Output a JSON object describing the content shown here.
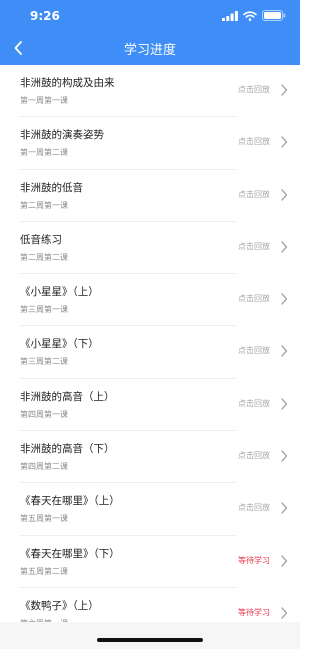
{
  "status_bar": {
    "time": "9:26"
  },
  "nav": {
    "title": "学习进度"
  },
  "items": [
    {
      "name": "非洲鼓的构成及由来",
      "sub": "第一周第一课",
      "status": "点击回放",
      "waiting": false
    },
    {
      "name": "非洲鼓的演奏姿势",
      "sub": "第一周第二课",
      "status": "点击回放",
      "waiting": false
    },
    {
      "name": "非洲鼓的低音",
      "sub": "第二周第一课",
      "status": "点击回放",
      "waiting": false
    },
    {
      "name": "低音练习",
      "sub": "第二周第二课",
      "status": "点击回放",
      "waiting": false
    },
    {
      "name": "《小星星》（上）",
      "sub": "第三周第一课",
      "status": "点击回放",
      "waiting": false
    },
    {
      "name": "《小星星》（下）",
      "sub": "第三周第二课",
      "status": "点击回放",
      "waiting": false
    },
    {
      "name": "非洲鼓的高音（上）",
      "sub": "第四周第一课",
      "status": "点击回放",
      "waiting": false
    },
    {
      "name": "非洲鼓的高音（下）",
      "sub": "第四周第二课",
      "status": "点击回放",
      "waiting": false
    },
    {
      "name": "《春天在哪里》（上）",
      "sub": "第五周第一课",
      "status": "点击回放",
      "waiting": false
    },
    {
      "name": "《春天在哪里》（下）",
      "sub": "第五周第二课",
      "status": "等待学习",
      "waiting": true
    },
    {
      "name": "《数鸭子》（上）",
      "sub": "第六周第一课",
      "status": "等待学习",
      "waiting": true
    }
  ],
  "colors": {
    "header": "#3f8ef7",
    "waiting": "#e8334a",
    "played": "#a6a6a6"
  }
}
